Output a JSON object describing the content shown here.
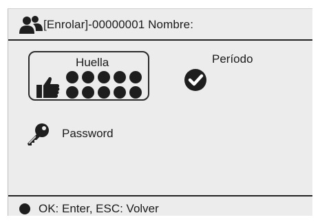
{
  "header": {
    "icon": "users-icon",
    "title": "[Enrolar]-00000001 Nombre:"
  },
  "fingerprint": {
    "label": "Huella",
    "icon": "thumbs-up-icon",
    "slots_total": 10,
    "slots_filled": 10
  },
  "period": {
    "label": "Período",
    "icon": "check-circle-icon",
    "checked": true
  },
  "password": {
    "label": "Password",
    "icon": "key-icon"
  },
  "footer": {
    "icon": "status-dot-icon",
    "text": "OK: Enter, ESC: Volver"
  },
  "colors": {
    "background": "#ececec",
    "foreground": "#1e1e1e",
    "border": "#222222"
  }
}
